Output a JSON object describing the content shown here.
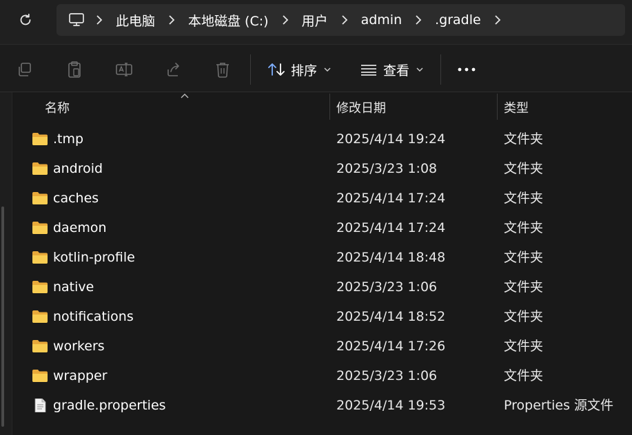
{
  "breadcrumb": {
    "items": [
      "此电脑",
      "本地磁盘 (C:)",
      "用户",
      "admin",
      ".gradle"
    ]
  },
  "toolbar": {
    "sort_label": "排序",
    "view_label": "查看"
  },
  "columns": {
    "name": "名称",
    "date": "修改日期",
    "type": "类型"
  },
  "files": [
    {
      "name": ".tmp",
      "date": "2025/4/14 19:24",
      "type": "文件夹",
      "kind": "folder"
    },
    {
      "name": "android",
      "date": "2025/3/23 1:08",
      "type": "文件夹",
      "kind": "folder"
    },
    {
      "name": "caches",
      "date": "2025/4/14 17:24",
      "type": "文件夹",
      "kind": "folder"
    },
    {
      "name": "daemon",
      "date": "2025/4/14 17:24",
      "type": "文件夹",
      "kind": "folder"
    },
    {
      "name": "kotlin-profile",
      "date": "2025/4/14 18:48",
      "type": "文件夹",
      "kind": "folder"
    },
    {
      "name": "native",
      "date": "2025/3/23 1:06",
      "type": "文件夹",
      "kind": "folder"
    },
    {
      "name": "notifications",
      "date": "2025/4/14 18:52",
      "type": "文件夹",
      "kind": "folder"
    },
    {
      "name": "workers",
      "date": "2025/4/14 17:26",
      "type": "文件夹",
      "kind": "folder"
    },
    {
      "name": "wrapper",
      "date": "2025/3/23 1:06",
      "type": "文件夹",
      "kind": "folder"
    },
    {
      "name": "gradle.properties",
      "date": "2025/4/14 19:53",
      "type": "Properties 源文件",
      "kind": "file"
    }
  ],
  "colors": {
    "background": "#191919",
    "folder": "#f7c948",
    "text": "#ffffff"
  }
}
